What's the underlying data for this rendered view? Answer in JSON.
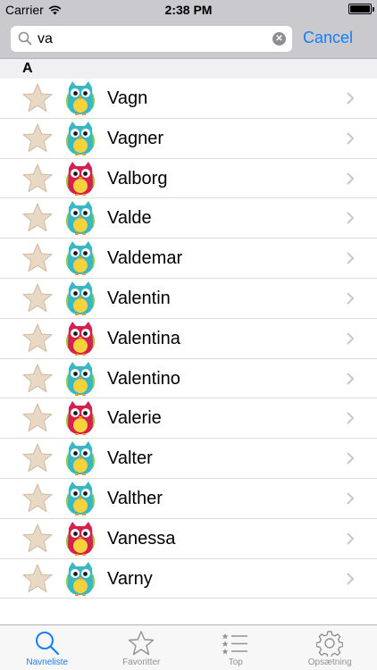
{
  "status_bar": {
    "carrier": "Carrier",
    "time": "2:38 PM",
    "battery_level": 1.0
  },
  "search": {
    "value": "va",
    "cancel_label": "Cancel"
  },
  "section": {
    "header": "A"
  },
  "names": [
    {
      "name": "Vagn",
      "gender": "boy"
    },
    {
      "name": "Vagner",
      "gender": "boy"
    },
    {
      "name": "Valborg",
      "gender": "girl"
    },
    {
      "name": "Valde",
      "gender": "boy"
    },
    {
      "name": "Valdemar",
      "gender": "boy"
    },
    {
      "name": "Valentin",
      "gender": "boy"
    },
    {
      "name": "Valentina",
      "gender": "girl"
    },
    {
      "name": "Valentino",
      "gender": "boy"
    },
    {
      "name": "Valerie",
      "gender": "girl"
    },
    {
      "name": "Valter",
      "gender": "boy"
    },
    {
      "name": "Valther",
      "gender": "boy"
    },
    {
      "name": "Vanessa",
      "gender": "girl"
    },
    {
      "name": "Varny",
      "gender": "boy"
    }
  ],
  "colors": {
    "accent": "#157efb",
    "owl_boy": "#3bb7c4",
    "owl_girl": "#d6204e",
    "star": "#e8d8c4"
  },
  "tab_bar": {
    "tabs": [
      {
        "label": "Navneliste",
        "icon": "search-icon",
        "active": true
      },
      {
        "label": "Favoritter",
        "icon": "star-icon",
        "active": false
      },
      {
        "label": "Top",
        "icon": "list-icon",
        "active": false
      },
      {
        "label": "Opsætning",
        "icon": "gear-icon",
        "active": false
      }
    ]
  }
}
